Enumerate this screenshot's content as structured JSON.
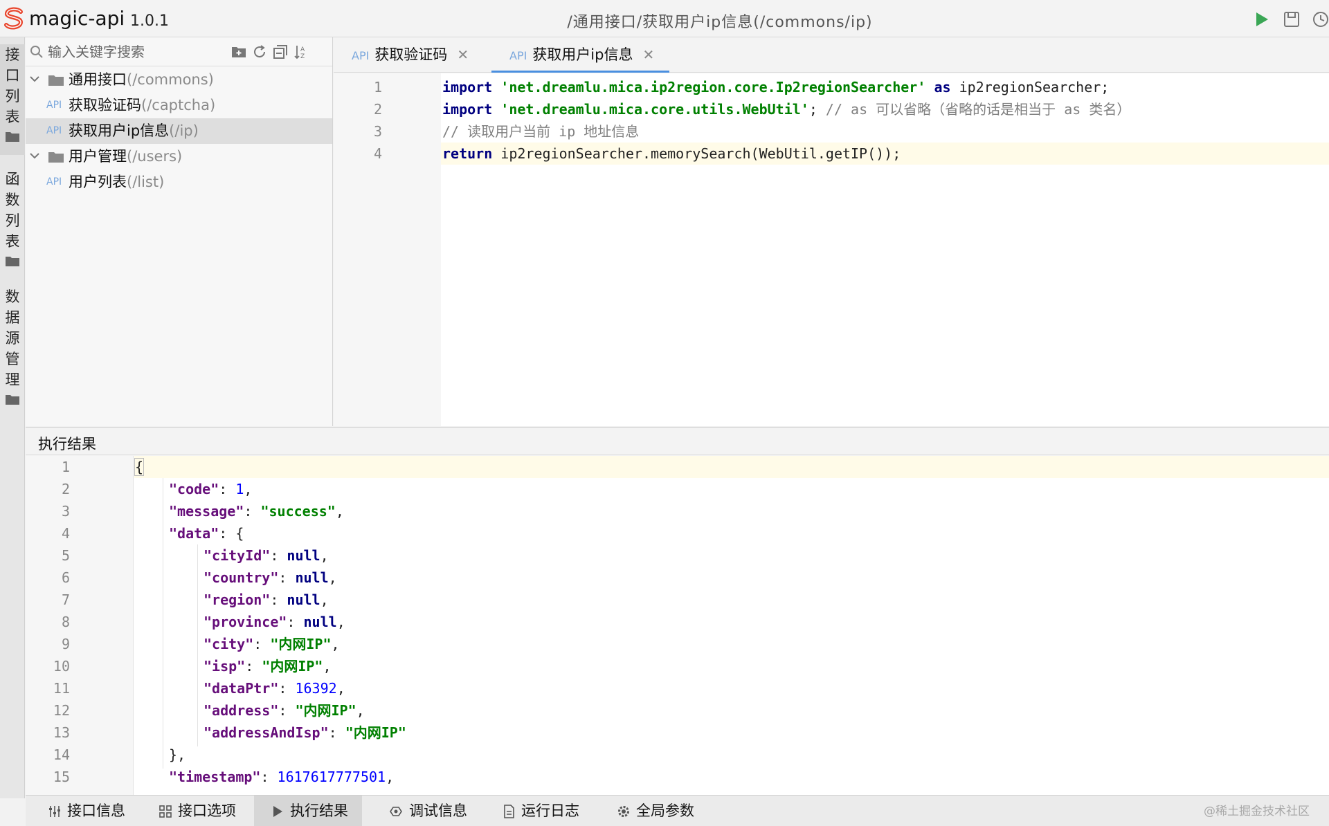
{
  "app": {
    "name": "magic-api",
    "version": "1.0.1",
    "path_title": "/通用接口/获取用户ip信息(/commons/ip)"
  },
  "rail": {
    "groups": [
      {
        "chars": [
          "接",
          "口",
          "列",
          "表"
        ]
      },
      {
        "chars": [
          "函",
          "数",
          "列",
          "表"
        ]
      },
      {
        "chars": [
          "数",
          "据",
          "源",
          "管",
          "理"
        ]
      }
    ]
  },
  "sidebar": {
    "search_placeholder": "输入关键字搜索",
    "tree": [
      {
        "name": "通用接口",
        "path": "(/commons)"
      },
      {
        "api_tag": "API",
        "name": "获取验证码",
        "path": "(/captcha)"
      },
      {
        "api_tag": "API",
        "name": "获取用户ip信息",
        "path": "(/ip)"
      },
      {
        "name": "用户管理",
        "path": "(/users)"
      },
      {
        "api_tag": "API",
        "name": "用户列表",
        "path": "(/list)"
      }
    ]
  },
  "tabs": [
    {
      "api_tag": "API",
      "label": "获取验证码",
      "close": "✕"
    },
    {
      "api_tag": "API",
      "label": "获取用户ip信息",
      "close": "✕"
    }
  ],
  "editor": {
    "line_numbers": [
      "1",
      "2",
      "3",
      "4"
    ],
    "line1": {
      "kw": "import",
      "str": "'net.dreamlu.mica.ip2region.core.Ip2regionSearcher'",
      "as": "as",
      "rest": "ip2regionSearcher;"
    },
    "line2": {
      "kw": "import",
      "str": "'net.dreamlu.mica.core.utils.WebUtil'",
      "semi": ";",
      "comment": "// as 可以省略（省略的话是相当于 as 类名）"
    },
    "line3": {
      "comment": "// 读取用户当前 ip 地址信息"
    },
    "line4": {
      "kw": "return",
      "rest": "ip2regionSearcher.memorySearch(WebUtil.getIP());"
    }
  },
  "result": {
    "title": "执行结果",
    "line_numbers": [
      "1",
      "2",
      "3",
      "4",
      "5",
      "6",
      "7",
      "8",
      "9",
      "10",
      "11",
      "12",
      "13",
      "14",
      "15"
    ],
    "code": "1",
    "message": "\"success\"",
    "cityId": "null",
    "country": "null",
    "region": "null",
    "province": "null",
    "city": "\"内网IP\"",
    "isp": "\"内网IP\"",
    "dataPtr": "16392",
    "address": "\"内网IP\"",
    "addressAndIsp": "\"内网IP\"",
    "timestamp": "1617617777501"
  },
  "bottombar": {
    "items": [
      "接口信息",
      "接口选项",
      "执行结果",
      "调试信息",
      "运行日志",
      "全局参数"
    ],
    "active": "执行结果",
    "watermark": "@稀土掘金技术社区"
  },
  "colors": {
    "accent": "#4a8fe0",
    "run": "#3aa655",
    "logo": "#e8452c"
  },
  "icons": [
    "logo-icon",
    "run-icon",
    "save-icon",
    "history-icon",
    "search-icon",
    "new-folder-icon",
    "refresh-icon",
    "collapse-icon",
    "sort-icon",
    "folder-icon",
    "chevron-down-icon",
    "close-icon",
    "settings-icon",
    "options-icon",
    "play-icon",
    "debug-icon",
    "log-icon",
    "gear-icon"
  ]
}
